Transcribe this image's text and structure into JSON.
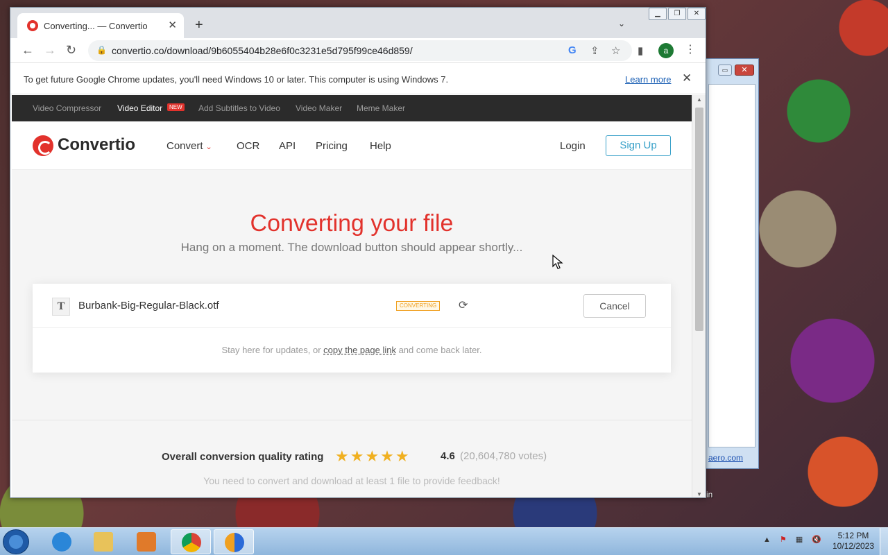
{
  "browser": {
    "tab_title": "Converting... — Convertio",
    "new_tab": "+",
    "url": "convertio.co/download/9b6055404b28e6f0c3231e5d795f99ce46d859/",
    "avatar_letter": "a",
    "infobar": {
      "message": "To get future Google Chrome updates, you'll need Windows 10 or later. This computer is using Windows 7.",
      "learn_more": "Learn more"
    }
  },
  "topstrip": {
    "items": [
      "Video Compressor",
      "Video Editor",
      "Add Subtitles to Video",
      "Video Maker",
      "Meme Maker"
    ],
    "new_badge": "NEW"
  },
  "header": {
    "brand": "Convertio",
    "nav": [
      "Convert",
      "OCR",
      "API",
      "Pricing",
      "Help"
    ],
    "login": "Login",
    "signup": "Sign Up"
  },
  "main": {
    "title": "Converting your file",
    "subtitle": "Hang on a moment. The download button should appear shortly...",
    "file": {
      "icon_letter": "T",
      "name": "Burbank-Big-Regular-Black.otf",
      "status": "CONVERTING",
      "cancel": "Cancel"
    },
    "stay_prefix": "Stay here for updates, or ",
    "stay_link": "copy the page link",
    "stay_suffix": " and come back later."
  },
  "rating": {
    "label": "Overall conversion quality rating",
    "stars": "★★★★★",
    "stars_value": 4.6,
    "score": "4.6",
    "votes": "(20,604,780 votes)",
    "feedback": "You need to convert and download at least 1 file to provide feedback!"
  },
  "background_window": {
    "link": "aero.com"
  },
  "desktop": {
    "recycle_label": "e Bin"
  },
  "taskbar": {
    "time": "5:12 PM",
    "date": "10/12/2023"
  },
  "colors": {
    "brand_red": "#e2322c",
    "signup_blue": "#39a1c9",
    "status_orange": "#f0a020",
    "star_gold": "#f0b020"
  }
}
